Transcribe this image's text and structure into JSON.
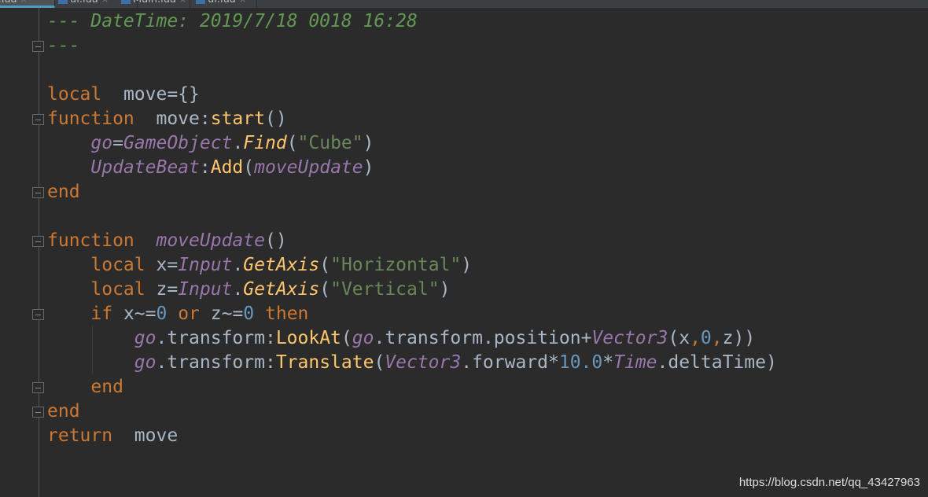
{
  "tabs": [
    {
      "label": "ove.lua",
      "active": true
    },
    {
      "label": "ui.lua"
    },
    {
      "label": "Main.lua"
    },
    {
      "label": "ui.lua"
    }
  ],
  "code_lines": [
    [
      [
        "cm",
        "--- DateTime: 2019/7/18 0018 16:28"
      ]
    ],
    [
      [
        "cm",
        "---"
      ]
    ],
    [],
    [
      [
        "kw",
        "local"
      ],
      [
        "",
        "  move={}"
      ]
    ],
    [
      [
        "kw",
        "function"
      ],
      [
        "",
        "  move:"
      ],
      [
        "fn",
        "start"
      ],
      [
        "",
        "()"
      ]
    ],
    [
      [
        "",
        "    "
      ],
      [
        "pi",
        "go"
      ],
      [
        "",
        "="
      ],
      [
        "pi",
        "GameObject"
      ],
      [
        "",
        "."
      ],
      [
        "fi",
        "Find"
      ],
      [
        "",
        "("
      ],
      [
        "st",
        "\"Cube\""
      ],
      [
        "",
        ")"
      ]
    ],
    [
      [
        "",
        "    "
      ],
      [
        "pi",
        "UpdateBeat"
      ],
      [
        "",
        ":"
      ],
      [
        "fn",
        "Add"
      ],
      [
        "",
        "("
      ],
      [
        "pi",
        "moveUpdate"
      ],
      [
        "",
        ")"
      ]
    ],
    [
      [
        "kw",
        "end"
      ]
    ],
    [],
    [
      [
        "kw",
        "function"
      ],
      [
        "",
        "  "
      ],
      [
        "pi",
        "moveUpdate"
      ],
      [
        "",
        "()"
      ]
    ],
    [
      [
        "",
        "    "
      ],
      [
        "kw",
        "local"
      ],
      [
        "",
        " x="
      ],
      [
        "pi",
        "Input"
      ],
      [
        "",
        "."
      ],
      [
        "fi",
        "GetAxis"
      ],
      [
        "",
        "("
      ],
      [
        "st",
        "\"Horizontal\""
      ],
      [
        "",
        ")"
      ]
    ],
    [
      [
        "",
        "    "
      ],
      [
        "kw",
        "local"
      ],
      [
        "",
        " z="
      ],
      [
        "pi",
        "Input"
      ],
      [
        "",
        "."
      ],
      [
        "fi",
        "GetAxis"
      ],
      [
        "",
        "("
      ],
      [
        "st",
        "\"Vertical\""
      ],
      [
        "",
        ")"
      ]
    ],
    [
      [
        "",
        "    "
      ],
      [
        "kw",
        "if"
      ],
      [
        "",
        " x~="
      ],
      [
        "nu",
        "0"
      ],
      [
        "",
        " "
      ],
      [
        "kw",
        "or"
      ],
      [
        "",
        " z~="
      ],
      [
        "nu",
        "0"
      ],
      [
        "",
        " "
      ],
      [
        "kw",
        "then"
      ]
    ],
    [
      [
        "",
        "        "
      ],
      [
        "pi",
        "go"
      ],
      [
        "",
        ".transform:"
      ],
      [
        "fn",
        "LookAt"
      ],
      [
        "",
        "("
      ],
      [
        "pi",
        "go"
      ],
      [
        "",
        ".transform.position+"
      ],
      [
        "pi",
        "Vector3"
      ],
      [
        "",
        "(x"
      ],
      [
        "kw",
        ","
      ],
      [
        "nu",
        "0"
      ],
      [
        "kw",
        ","
      ],
      [
        "",
        "z))"
      ]
    ],
    [
      [
        "",
        "        "
      ],
      [
        "pi",
        "go"
      ],
      [
        "",
        ".transform:"
      ],
      [
        "fn",
        "Translate"
      ],
      [
        "",
        "("
      ],
      [
        "pi",
        "Vector3"
      ],
      [
        "",
        ".forward*"
      ],
      [
        "nu",
        "10.0"
      ],
      [
        "",
        "*"
      ],
      [
        "pi",
        "Time"
      ],
      [
        "",
        ".deltaTime)"
      ]
    ],
    [
      [
        "",
        "    "
      ],
      [
        "kw",
        "end"
      ]
    ],
    [
      [
        "kw",
        "end"
      ]
    ],
    [
      [
        "kw",
        "return"
      ],
      [
        "",
        "  move"
      ]
    ]
  ],
  "fold_lines": [
    2,
    5,
    8,
    10,
    13,
    16,
    17
  ],
  "watermark": "https://blog.csdn.net/qq_43427963"
}
